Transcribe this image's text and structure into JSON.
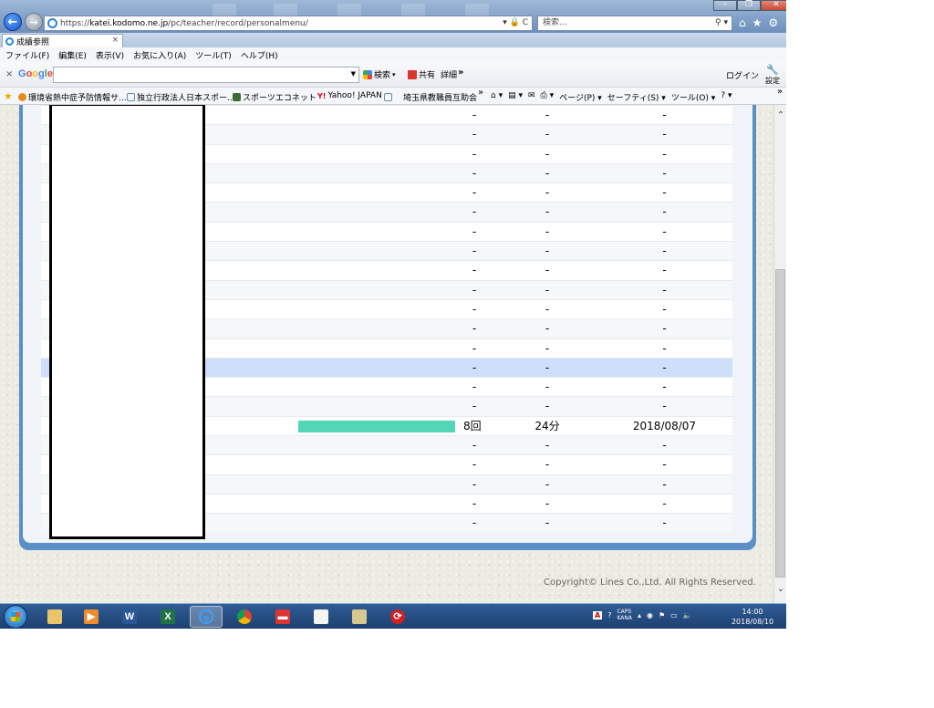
{
  "browser": {
    "url_prefix": "https://",
    "url_domain": "katei.kodomo.ne.jp",
    "url_path": "/pc/teacher/record/personalmenu/",
    "addr_tools": "▾ 🔒 C",
    "search_placeholder": "検索...",
    "tab_title": "成績参照",
    "tab_close": "×"
  },
  "menu": [
    "ファイル(F)",
    "編集(E)",
    "表示(V)",
    "お気に入り(A)",
    "ツール(T)",
    "ヘルプ(H)"
  ],
  "google_toolbar": {
    "close": "×",
    "logo": "Google",
    "search_label": "検索",
    "share_label": "共有",
    "detail_label": "詳細",
    "more": "»",
    "login_label": "ログイン",
    "settings_label": "設定"
  },
  "favorites": [
    "環境省熱中症予防情報サ...",
    "独立行政法人日本スポー...",
    "スポーツエコネット",
    "Yahoo! JAPAN",
    "埼玉県教職員互助会"
  ],
  "favorites_more": "»",
  "command_bar": [
    "ページ(P) ▾",
    "セーフティ(S) ▾",
    "ツール(O) ▾",
    "? ▾"
  ],
  "records": [
    {
      "count": "-",
      "time": "-",
      "date": "-"
    },
    {
      "count": "-",
      "time": "-",
      "date": "-"
    },
    {
      "count": "-",
      "time": "-",
      "date": "-"
    },
    {
      "count": "-",
      "time": "-",
      "date": "-"
    },
    {
      "count": "-",
      "time": "-",
      "date": "-"
    },
    {
      "count": "-",
      "time": "-",
      "date": "-"
    },
    {
      "count": "-",
      "time": "-",
      "date": "-"
    },
    {
      "count": "-",
      "time": "-",
      "date": "-"
    },
    {
      "count": "-",
      "time": "-",
      "date": "-"
    },
    {
      "count": "-",
      "time": "-",
      "date": "-"
    },
    {
      "count": "-",
      "time": "-",
      "date": "-"
    },
    {
      "count": "-",
      "time": "-",
      "date": "-"
    },
    {
      "count": "-",
      "time": "-",
      "date": "-"
    },
    {
      "count": "-",
      "time": "-",
      "date": "-",
      "selected": true
    },
    {
      "count": "-",
      "time": "-",
      "date": "-"
    },
    {
      "count": "-",
      "time": "-",
      "date": "-"
    },
    {
      "count": "8回",
      "time": "24分",
      "date": "2018/08/07",
      "bar": 0.82
    },
    {
      "count": "-",
      "time": "-",
      "date": "-"
    },
    {
      "count": "-",
      "time": "-",
      "date": "-"
    },
    {
      "count": "-",
      "time": "-",
      "date": "-"
    },
    {
      "count": "-",
      "time": "-",
      "date": "-"
    },
    {
      "count": "-",
      "time": "-",
      "date": "-"
    }
  ],
  "colors": {
    "bar": "#52d6b6",
    "panel_frame": "#5b8fc8",
    "selected_row": "#cfdffb"
  },
  "copyright": "Copyright© Lines Co.,Ltd. All Rights Reserved.",
  "taskbar": {
    "apps": [
      "explorer",
      "media-player",
      "word",
      "excel",
      "internet-explorer",
      "chrome",
      "app-red",
      "document",
      "notes",
      "trend-micro"
    ],
    "active_app": "internet-explorer",
    "ime_labels": [
      "A",
      "CAPS",
      "KANA"
    ],
    "time": "14:00",
    "date": "2018/08/10"
  }
}
